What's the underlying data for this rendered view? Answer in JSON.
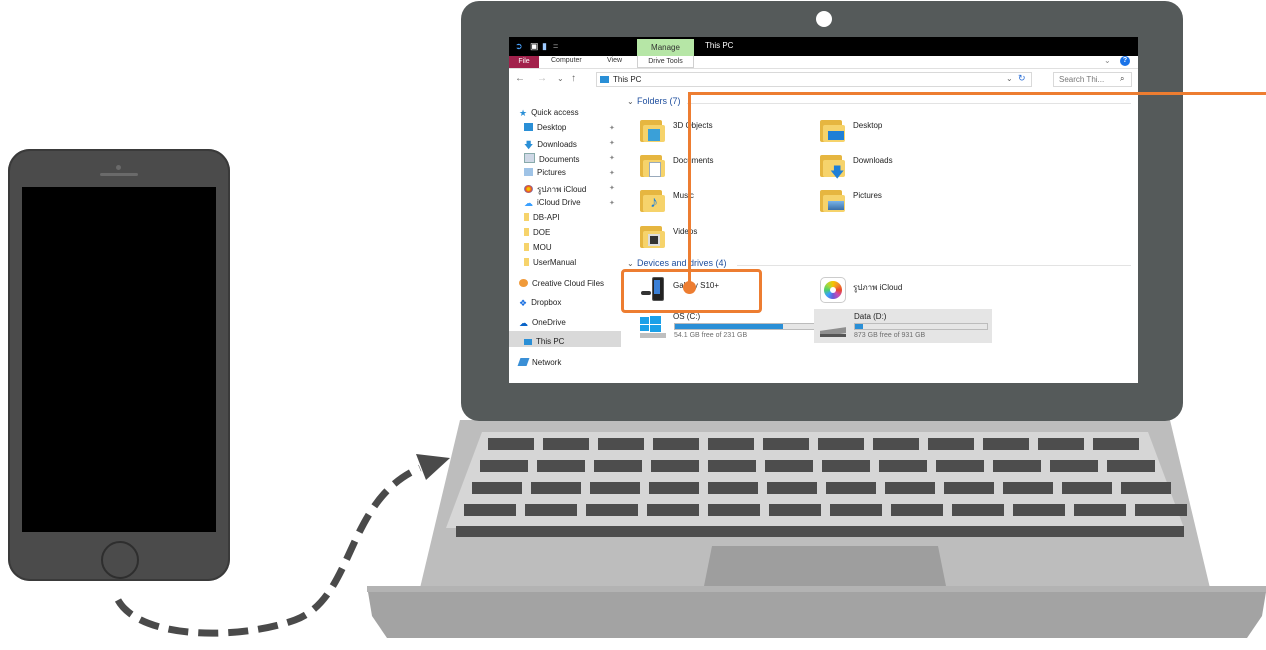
{
  "explorer": {
    "quick_toolbar_icons": [
      "app-icon",
      "properties-icon",
      "new-folder-icon"
    ],
    "context_tab": "Manage",
    "window_title": "This PC",
    "ribbon_tabs": {
      "file": "File",
      "computer": "Computer",
      "view": "View",
      "drive_tools": "Drive Tools"
    },
    "address": {
      "path_label": "This PC",
      "search_placeholder": "Search Thi..."
    },
    "nav_pane": {
      "quick_access": "Quick access",
      "items": [
        {
          "label": "Desktop",
          "pinned": true
        },
        {
          "label": "Downloads",
          "pinned": true
        },
        {
          "label": "Documents",
          "pinned": true
        },
        {
          "label": "Pictures",
          "pinned": true
        },
        {
          "label": "รูปภาพ iCloud",
          "pinned": true
        },
        {
          "label": "iCloud Drive",
          "pinned": true
        },
        {
          "label": "DB-API",
          "pinned": false
        },
        {
          "label": "DOE",
          "pinned": false
        },
        {
          "label": "MOU",
          "pinned": false
        },
        {
          "label": "UserManual",
          "pinned": false
        }
      ],
      "creative_cloud": "Creative Cloud Files",
      "dropbox": "Dropbox",
      "onedrive": "OneDrive",
      "this_pc": "This PC",
      "network": "Network"
    },
    "folders_header": "Folders (7)",
    "folders": [
      "3D Objects",
      "Desktop",
      "Documents",
      "Downloads",
      "Music",
      "Pictures",
      "Videos"
    ],
    "devices_header": "Devices and drives (4)",
    "devices": [
      {
        "label": "Galaxy S10+",
        "highlighted": true
      },
      {
        "label": "รูปภาพ iCloud"
      }
    ],
    "drives": [
      {
        "label": "OS (C:)",
        "free_text": "54.1 GB free of 231 GB",
        "used_fraction": 0.77
      },
      {
        "label": "Data (D:)",
        "free_text": "873 GB free of 931 GB",
        "used_fraction": 0.06
      }
    ]
  },
  "colors": {
    "highlight": "#ed7d31",
    "file_tab": "#a2214b",
    "manage_tab": "#b6e6a6",
    "drive_fill": "#2a8fd6",
    "laptop_bezel": "#555a5a",
    "phone_body": "#4b4b4b"
  },
  "scene": {
    "connection_arrow": "dashed-curved-arrow"
  }
}
